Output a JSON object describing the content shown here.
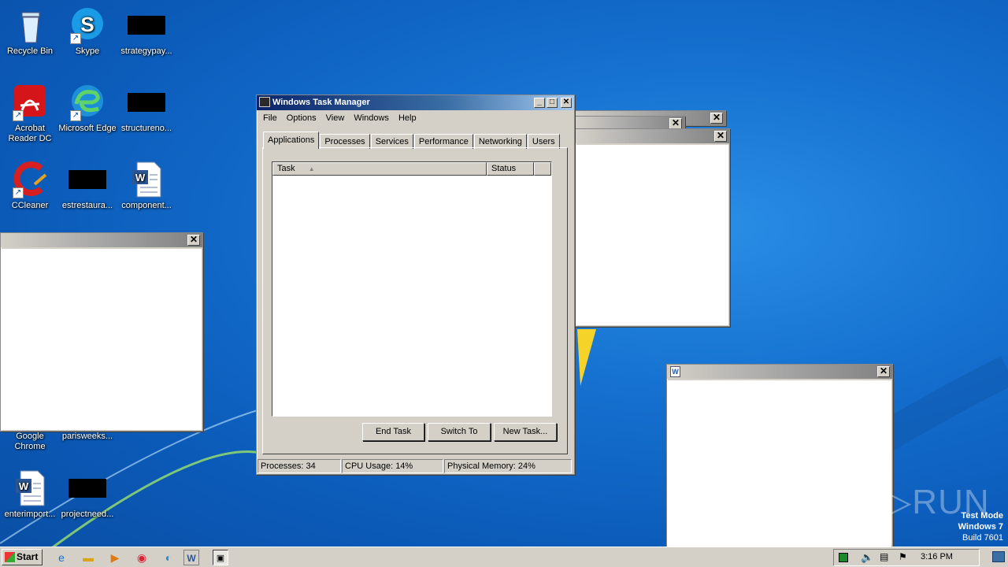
{
  "desktop": {
    "icons": [
      {
        "label": "Recycle Bin",
        "icon": "recycle-bin-icon"
      },
      {
        "label": "Skype",
        "icon": "skype-icon"
      },
      {
        "label": "strategypay...",
        "icon": "redacted-icon"
      },
      {
        "label": "Acrobat Reader DC",
        "icon": "acrobat-icon"
      },
      {
        "label": "Microsoft Edge",
        "icon": "edge-icon"
      },
      {
        "label": "structureno...",
        "icon": "redacted-icon"
      },
      {
        "label": "CCleaner",
        "icon": "ccleaner-icon"
      },
      {
        "label": "estrestaura...",
        "icon": "redacted-icon"
      },
      {
        "label": "component...",
        "icon": "word-doc-icon"
      },
      {
        "label": "Google Chrome",
        "icon": "chrome-icon"
      },
      {
        "label": "parisweeks...",
        "icon": "redacted-icon"
      },
      {
        "label": "enterimport...",
        "icon": "word-doc-icon"
      },
      {
        "label": "projectneed...",
        "icon": "redacted-icon"
      }
    ]
  },
  "task_manager": {
    "title": "Windows Task Manager",
    "menu": [
      "File",
      "Options",
      "View",
      "Windows",
      "Help"
    ],
    "tabs": [
      "Applications",
      "Processes",
      "Services",
      "Performance",
      "Networking",
      "Users"
    ],
    "active_tab": "Applications",
    "columns": [
      "Task",
      "Status"
    ],
    "buttons": {
      "end_task": "End Task",
      "switch_to": "Switch To",
      "new_task": "New Task..."
    },
    "status": {
      "processes": "Processes: 34",
      "cpu": "CPU Usage: 14%",
      "memory": "Physical Memory: 24%"
    }
  },
  "taskbar": {
    "start_label": "Start",
    "clock": "3:16 PM"
  },
  "watermark": {
    "brand": "ANY▷RUN",
    "line1": "Test Mode",
    "line2": "Windows 7",
    "line3": "Build 7601"
  },
  "colors": {
    "titlebar_active": "#0a246a",
    "desktop": "#1570cf"
  }
}
